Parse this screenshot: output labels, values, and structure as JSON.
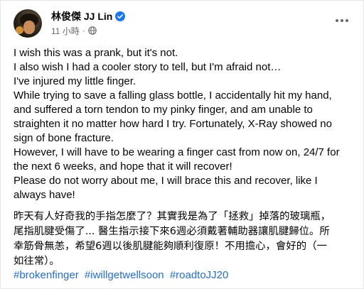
{
  "post": {
    "author": "林俊傑 JJ Lin",
    "time": "11 小時",
    "dot": "·",
    "audience_icon": "globe-icon",
    "verified_icon": "verified-badge-icon",
    "more_icon": "more-options-icon",
    "verified_color": "#1877f2",
    "link_color": "#216fdb",
    "english_lines": [
      "I wish this was a prank, but it's not.",
      "I also wish I had a cooler story to tell, but I'm afraid not…",
      "I've injured my little finger.",
      "While trying to save a falling glass bottle, I accidentally hit my hand,",
      "and suffered a torn tendon to my pinky finger, and am unable to",
      "straighten it no matter how hard I try. Fortunately, X-Ray showed no",
      "sign of bone fracture.",
      "However, I will have to be wearing a finger cast from now on, 24/7 for",
      "the next 6 weeks, and hope that it will recover!",
      "Please do not worry about me, I will brace this and recover, like I",
      "always have!"
    ],
    "chinese_lines": [
      "昨天有人好奇我的手指怎麼了？其實我是為了「拯救」掉落的玻璃瓶，",
      "尾指肌腱受傷了... 醫生指示接下來6週必須戴著輔助器讓肌腱歸位。所",
      "幸筋骨無恙，希望6週以後肌腱能夠順利復原！不用擔心，會好的（一",
      "如往常）。"
    ],
    "hashtags": [
      "#brokenfinger",
      "#iwillgetwellsoon",
      "#roadtoJJ20"
    ]
  }
}
